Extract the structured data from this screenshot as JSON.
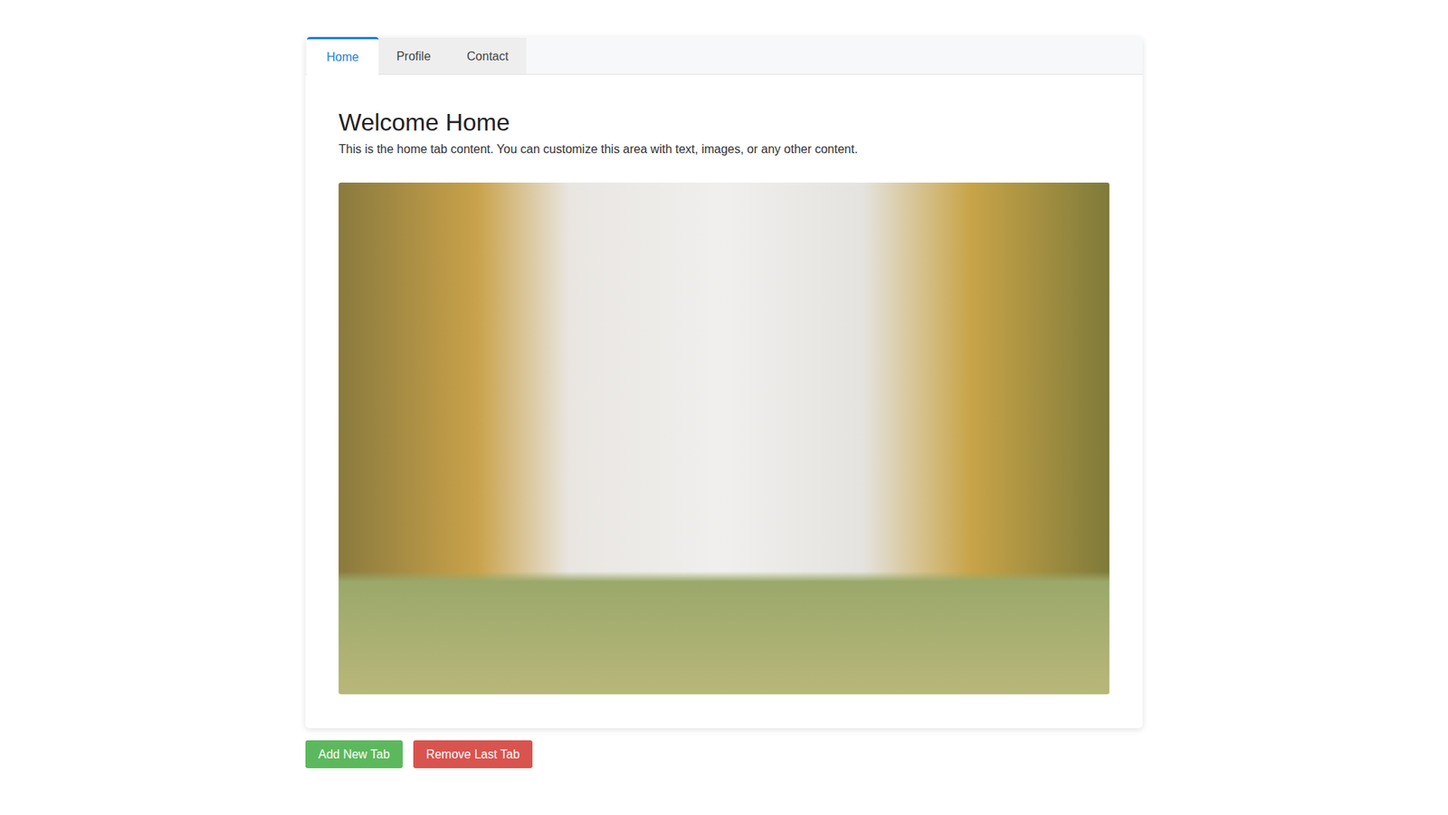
{
  "tabs": [
    {
      "label": "Home",
      "selected": true
    },
    {
      "label": "Profile",
      "selected": false
    },
    {
      "label": "Contact",
      "selected": false
    }
  ],
  "panel": {
    "heading": "Welcome Home",
    "text": "This is the home tab content. You can customize this area with text, images, or any other content."
  },
  "buttons": [
    {
      "label": "Add New Tab",
      "color": "#5cb85c"
    },
    {
      "label": "Remove Last Tab",
      "color": "#d9534f"
    }
  ]
}
